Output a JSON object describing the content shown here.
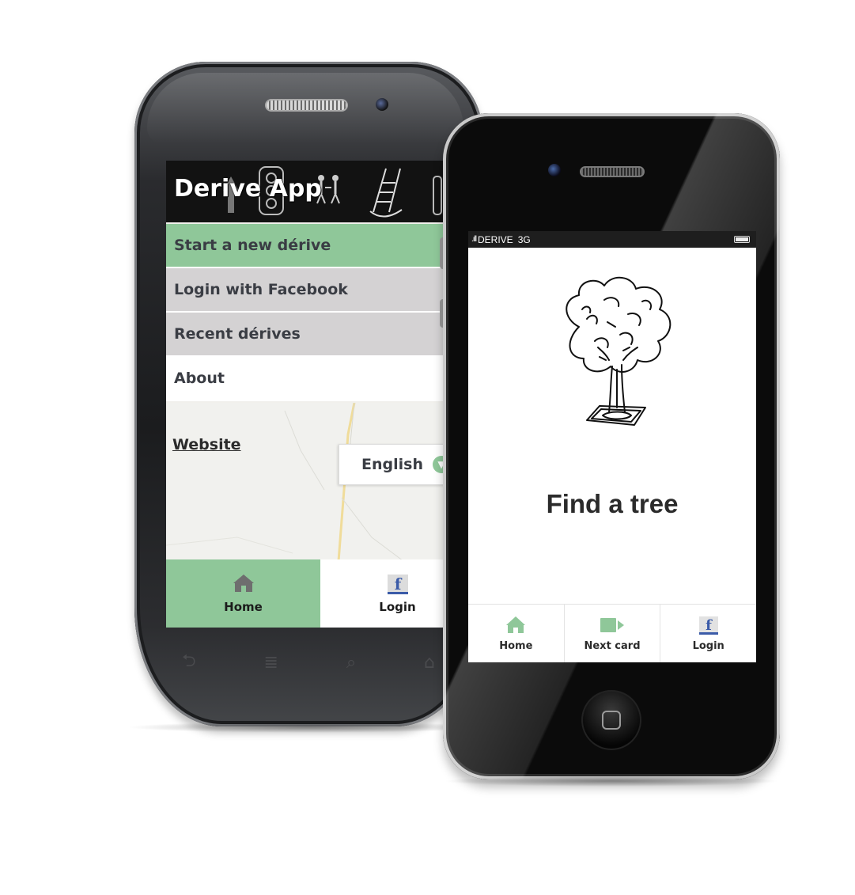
{
  "android": {
    "header_title": "Derive App",
    "menu": [
      {
        "label": "Start a new dérive",
        "style": "green"
      },
      {
        "label": "Login with Facebook",
        "style": "grey"
      },
      {
        "label": "Recent dérives",
        "style": "grey"
      },
      {
        "label": "About",
        "style": "white"
      }
    ],
    "website_link": "Website",
    "language_selected": "English",
    "tabs": {
      "home": "Home",
      "login": "Login"
    },
    "facebook_letter": "f",
    "nav_keys": [
      "back-icon",
      "menu-icon",
      "search-icon",
      "home-outline-icon"
    ]
  },
  "iphone": {
    "carrier": "DERIVE",
    "network": "3G",
    "card_title": "Find a tree",
    "tabs": {
      "home": "Home",
      "next": "Next card",
      "login": "Login"
    },
    "facebook_letter": "f"
  },
  "colors": {
    "accent_green": "#8fc799",
    "menu_grey": "#d4d2d3",
    "facebook_blue": "#3b5ba8",
    "icon_grey": "#6e6e6e"
  }
}
